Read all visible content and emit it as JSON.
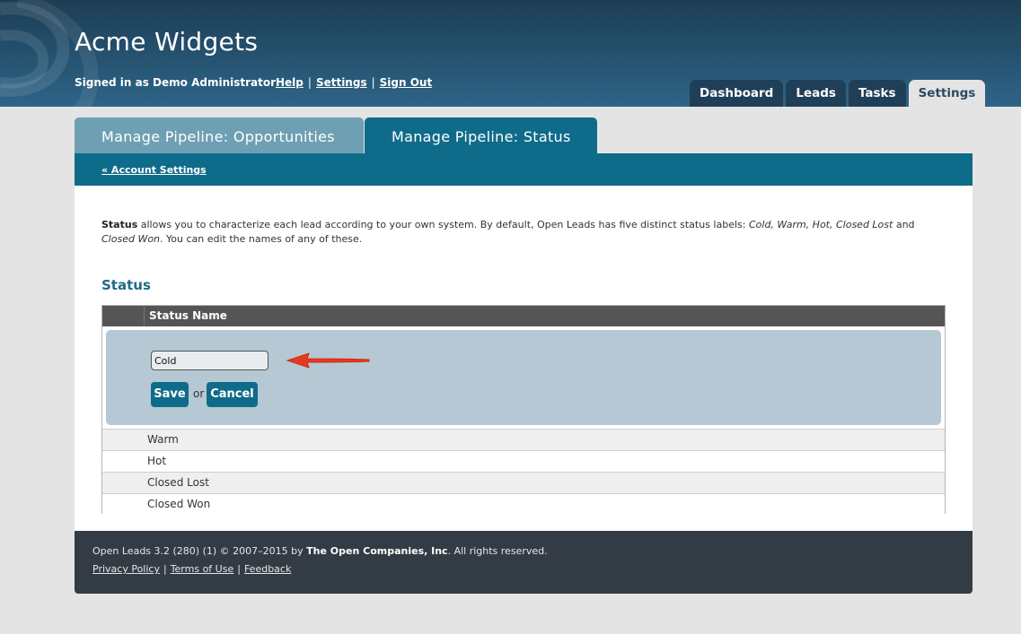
{
  "header": {
    "app_title": "Acme Widgets",
    "signed_in": "Signed in as Demo Administrator",
    "links": {
      "help": "Help",
      "settings": "Settings",
      "sign_out": "Sign Out",
      "separator": "|"
    },
    "tabs": [
      {
        "label": "Dashboard",
        "active": false
      },
      {
        "label": "Leads",
        "active": false
      },
      {
        "label": "Tasks",
        "active": false
      },
      {
        "label": "Settings",
        "active": true
      }
    ]
  },
  "subtabs": [
    {
      "label": "Manage Pipeline: Opportunities",
      "active": false
    },
    {
      "label": "Manage Pipeline: Status",
      "active": true
    }
  ],
  "back_link": "« Account Settings",
  "description": {
    "lead_bold": "Status",
    "text1": " allows you to characterize each lead according to your own system. By default, Open Leads has five distinct status labels: ",
    "labels_italic": "Cold, Warm, Hot, Closed Lost",
    "and": " and ",
    "last_italic": "Closed Won",
    "text2": ". You can edit the names of any of these."
  },
  "section_title": "Status",
  "table": {
    "header": "Status Name",
    "editing": {
      "input_value": "Cold",
      "save_label": "Save",
      "or_label": "or",
      "cancel_label": "Cancel"
    },
    "rows": [
      "Warm",
      "Hot",
      "Closed Lost",
      "Closed Won"
    ]
  },
  "footer": {
    "line1_prefix": "Open Leads 3.2 (280) (1) © 2007–2015 by ",
    "company": "The Open Companies, Inc",
    "line1_suffix": ". All rights reserved.",
    "privacy": "Privacy Policy",
    "terms": "Terms of Use",
    "feedback": "Feedback",
    "separator": "|"
  },
  "colors": {
    "header_dark": "#1d3d54",
    "accent_blue": "#0f6b8a",
    "inactive_tab": "#6e9fb3",
    "edit_row_bg": "#b6c8d4",
    "footer_bg": "#333c45",
    "arrow_red": "#e8391f"
  },
  "icons": {
    "pointer": "red-arrow-icon",
    "logo_swirl": "swirl-logo-icon"
  }
}
